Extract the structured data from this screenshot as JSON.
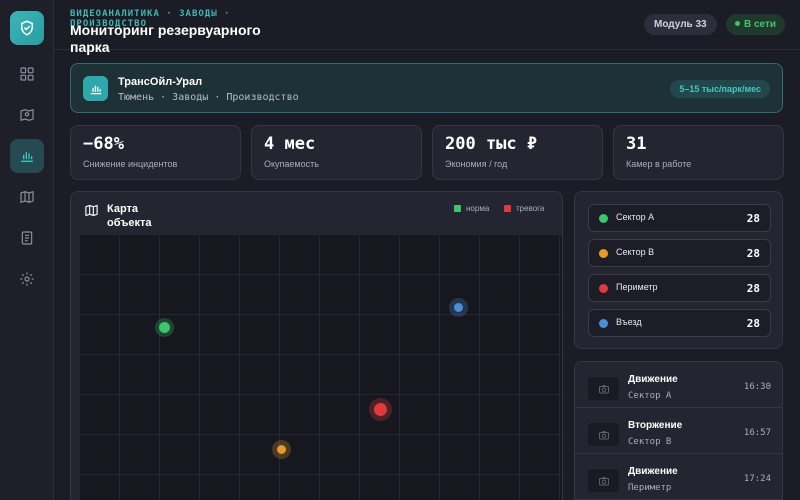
{
  "header": {
    "breadcrumb": "ВИДЕОАНАЛИТИКА · ЗАВОДЫ · ПРОИЗВОДСТВО",
    "title": "Мониторинг резервуарного парка",
    "module": "Модуль 33",
    "status": "В сети"
  },
  "sidebar": {
    "items": [
      {
        "icon": "shield-icon",
        "active": false
      },
      {
        "icon": "dashboard-icon",
        "active": false
      },
      {
        "icon": "camera-map-icon",
        "active": false
      },
      {
        "icon": "bar-chart-icon",
        "active": true
      },
      {
        "icon": "map-icon",
        "active": false
      },
      {
        "icon": "document-icon",
        "active": false
      },
      {
        "icon": "settings-icon",
        "active": false
      }
    ]
  },
  "company": {
    "name": "ТрансОйл-Урал",
    "subtitle": "Тюмень · Заводы · Производство",
    "price": "5–15 тыс/парк/мес"
  },
  "kpis": [
    {
      "value": "−68%",
      "label": "Снижение инцидентов"
    },
    {
      "value": "4 мес",
      "label": "Окупаемость"
    },
    {
      "value": "200 тыс ₽",
      "label": "Экономия / год"
    },
    {
      "value": "31",
      "label": "Камер в работе"
    }
  ],
  "map": {
    "title": "Карта объекта",
    "legend": [
      {
        "label": "норма",
        "color": "#3cc56a"
      },
      {
        "label": "тревога",
        "color": "#e0393e"
      }
    ],
    "cameras": [
      {
        "status": "normal",
        "color": "#3cc56a"
      },
      {
        "status": "info",
        "color": "#4a8fd6"
      },
      {
        "status": "alarm",
        "color": "#e0393e"
      },
      {
        "status": "warning",
        "color": "#e69a2b"
      }
    ]
  },
  "sectors": [
    {
      "name": "Сектор А",
      "count": "28",
      "color": "#3cc56a"
    },
    {
      "name": "Сектор В",
      "count": "28",
      "color": "#e69a2b"
    },
    {
      "name": "Периметр",
      "count": "28",
      "color": "#e0393e"
    },
    {
      "name": "Въезд",
      "count": "28",
      "color": "#4a8fd6"
    }
  ],
  "events": [
    {
      "type": "Движение",
      "location": "Сектор А",
      "time": "16:30"
    },
    {
      "type": "Вторжение",
      "location": "Сектор В",
      "time": "16:57"
    },
    {
      "type": "Движение",
      "location": "Периметр",
      "time": "17:24"
    }
  ]
}
